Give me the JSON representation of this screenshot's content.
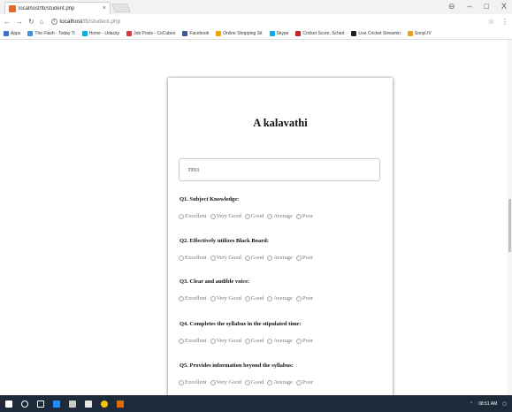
{
  "browser": {
    "tab_title": "localhost/fb/student.php",
    "tab_close": "×",
    "win_min": "–",
    "win_max": "□",
    "win_close": "X",
    "account_icon": "⊖",
    "url_host": "localhost",
    "url_path": "/fb/student.php",
    "star_icon": "☆",
    "menu_icon": "⋮",
    "bookmarks": [
      {
        "label": "Apps",
        "color": "#3a6fd8"
      },
      {
        "label": "The Flash - Today Ti",
        "color": "#4a90d9"
      },
      {
        "label": "Home - Udacity",
        "color": "#02b3e4"
      },
      {
        "label": "Job Posts - CoCubes",
        "color": "#d83a3a"
      },
      {
        "label": "Facebook",
        "color": "#3b5998"
      },
      {
        "label": "Online Shopping Sit",
        "color": "#f0a500"
      },
      {
        "label": "Skype",
        "color": "#00aff0"
      },
      {
        "label": "Cricket Score, Sched",
        "color": "#cc2222"
      },
      {
        "label": "Live Cricket Streamin",
        "color": "#222222"
      },
      {
        "label": "SonyLIV",
        "color": "#e8a020"
      }
    ]
  },
  "form": {
    "title": "A kalavathi",
    "id_value": "IT01",
    "options": [
      "Excellent",
      "Very Good",
      "Good",
      "Average",
      "Poor"
    ],
    "questions": [
      "Q1. Subject Knowledge:",
      "Q2. Effectively utilizes Black Board:",
      "Q3. Clear and audible voice:",
      "Q4. Completes the syllabus in the stipulated time:",
      "Q5. Provides information beyond the syllabus:"
    ]
  },
  "taskbar": {
    "time": "08:51 AM",
    "tray": "⌃"
  }
}
